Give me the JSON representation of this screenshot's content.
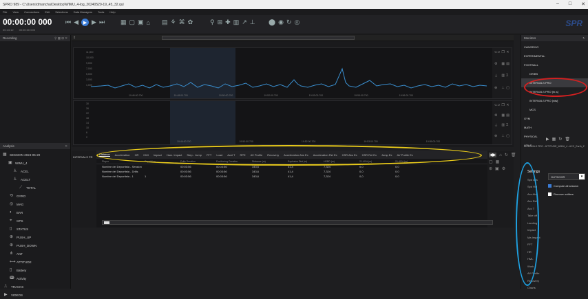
{
  "window": {
    "title": "SPRO 989 - C:\\Users\\dmancha\\Desktop\\WIMU_4-log_20240520-19_45_32.qul",
    "controls": [
      "–",
      "□",
      "✕"
    ]
  },
  "menu": [
    "File",
    "View",
    "Connections",
    "Edit",
    "Selections",
    "Data Managers",
    "Tools",
    "Help"
  ],
  "toolbar": {
    "time": "00:00:00 000",
    "subtime_left": "00:13:12",
    "subtime_right": "00:00:00 000",
    "brand": "SPR"
  },
  "recording_panel": {
    "title": "Recording"
  },
  "graphs": {
    "top_ylabels": [
      "11,000",
      "10,000",
      "9,000",
      "7,000",
      "5,000",
      "3,000",
      "1,000"
    ],
    "top_xlabels": [
      "19:46:00.700",
      "19:48:00.700",
      "19:50:00.700",
      "19:52:00.700",
      "19:53:00.700",
      "19:55:00.700",
      "19:56:00.700"
    ],
    "bottom_ylabels": [
      "30",
      "26",
      "22",
      "18",
      "14",
      "10",
      "6",
      "2"
    ],
    "bottom_xlabels": [
      "19:46:00.700",
      "19:50:00.700",
      "19:52:00.700",
      "19:53:00.700",
      "19:55:00.700"
    ]
  },
  "analysis": {
    "title": "Analysis",
    "items": [
      {
        "label": "SESSION 2024-05-20",
        "icon": "session-icon"
      },
      {
        "label": "WIMU_4",
        "icon": "device-icon"
      },
      {
        "label": "ACEL",
        "icon": "chart-icon"
      },
      {
        "label": "ACELT",
        "icon": "chart-icon"
      },
      {
        "label": "TOTAL",
        "icon": "line-icon"
      },
      {
        "label": "GYRO",
        "icon": "gyro-icon"
      },
      {
        "label": "MAG",
        "icon": "compass-icon"
      },
      {
        "label": "BAR",
        "icon": "gauge-icon"
      },
      {
        "label": "GPS",
        "icon": "gps-icon"
      },
      {
        "label": "STATUS",
        "icon": "status-icon"
      },
      {
        "label": "PUSH_UP",
        "icon": "push-icon"
      },
      {
        "label": "PUSH_DOWN",
        "icon": "push-icon"
      },
      {
        "label": "ANT",
        "icon": "antenna-icon"
      },
      {
        "label": "ATTITUDE",
        "icon": "attitude-icon"
      },
      {
        "label": "Battery",
        "icon": "battery-icon"
      },
      {
        "label": "Activity",
        "icon": "activity-icon"
      },
      {
        "label": "TRACKS",
        "icon": "tracks-icon"
      },
      {
        "label": "VIDEOS",
        "icon": "video-icon"
      }
    ]
  },
  "tabs": {
    "left_label": "INTERVALS PR",
    "items": [
      "Distance",
      "Acceleration",
      "HR",
      "HMI",
      "Impact",
      "Harz. Impact",
      "Step - Jump",
      "FFT",
      "Load",
      "Acel T",
      "RPE",
      "AV Profile",
      "Recovery",
      "Acceleration Abs Ex",
      "Acceleration Rel Ex",
      "HSR Abs Ex",
      "HSR Rel Ex",
      "Jump Ex",
      "AV Profile Ex"
    ]
  },
  "table": {
    "headers": [
      "Player",
      "Repetition",
      "Drills Duration",
      "Positioning Duration",
      "Distance (m)",
      "Explosive Dist (m)",
      "HSBD (m)",
      "21-40% (m)",
      "21-40% (m)"
    ],
    "rows": [
      [
        "Nombre del Deportista - Session",
        "",
        "00:03:56",
        "00:03:56",
        "343,6",
        "41,4",
        "7,324",
        "0,0",
        "0,0"
      ],
      [
        "Nombre del Deportista - Drills",
        "",
        "00:03:56",
        "00:03:56",
        "343,6",
        "41,4",
        "7,324",
        "0,0",
        "0,0"
      ],
      [
        "Nombre del Deportista - 1",
        "1",
        "00:03:56",
        "00:03:56",
        "343,6",
        "41,4",
        "7,324",
        "0,0",
        "0,0"
      ]
    ]
  },
  "monitor": {
    "title": "Monitors",
    "items": [
      {
        "label": "CANOEING",
        "level": 0
      },
      {
        "label": "EXPERIMENTAL",
        "level": 0
      },
      {
        "label": "FOOTBALL",
        "level": 0
      },
      {
        "label": "DRIBS",
        "level": 1
      },
      {
        "label": "INTERVALS PRO",
        "level": 1,
        "highlight": true
      },
      {
        "label": "INTERVALS PRO [hr-s]",
        "level": 1
      },
      {
        "label": "INTERVALS PRO [rdw]",
        "level": 1
      },
      {
        "label": "MCS",
        "level": 1
      },
      {
        "label": "GYM",
        "level": 0
      },
      {
        "label": "MATH",
        "level": 0
      },
      {
        "label": "PHYSICAL",
        "level": 0
      },
      {
        "label": "UTILS",
        "level": 0
      }
    ],
    "interval_label": "INTERVALS PRO - ATTITUDE_WIMU_4 - ACC_Earth_Z",
    "settings_title": "Settings",
    "dropdown_value": "OUTDOOR",
    "checkbox1": "Compute all session",
    "checkbox2": "Remove outliers",
    "setting_items": [
      "Spd Abs",
      "Spd Rel",
      "Acc Abs",
      "Acc Rel",
      "Acc T",
      "Take off",
      "Landing",
      "Impact",
      "Ma Impact",
      "FFT",
      "HR",
      "HML",
      "Work",
      "AV Profile",
      "Recovery",
      "Charts"
    ]
  }
}
